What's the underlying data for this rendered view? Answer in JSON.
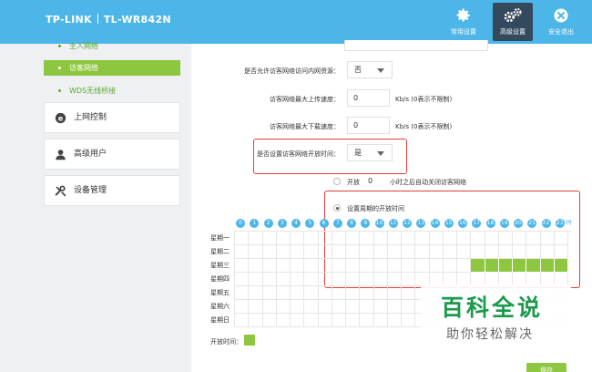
{
  "header": {
    "brand": "TP-LINK",
    "model": "TL-WR842N",
    "buttons": [
      {
        "label": "常用设置",
        "icon": "gear-icon"
      },
      {
        "label": "高级设置",
        "icon": "gears-icon",
        "active": true
      },
      {
        "label": "安全退出",
        "icon": "close-icon"
      }
    ],
    "colors": {
      "bar": "#4cb6e8",
      "active": "#34495e"
    }
  },
  "sidebar": {
    "subitems": [
      "主人网络",
      "访客网络",
      "WDS无线桥接"
    ],
    "active_subitem": "访客网络",
    "menus": [
      "上网控制",
      "高级用户",
      "设备管理"
    ]
  },
  "form": {
    "allow_intranet_label": "是否允许访客网络访问内网资源：",
    "allow_intranet_value": "否",
    "upload_label": "访客网络最大上传速度：",
    "upload_value": "0",
    "upload_unit": "Kb/s (0表示不限制)",
    "download_label": "访客网络最大下载速度：",
    "download_value": "0",
    "download_unit": "Kb/s (0表示不限制)",
    "set_time_label": "是否设置访客网络开放时间：",
    "set_time_value": "是",
    "open_option_prefix": "开放",
    "open_option_hours": "0",
    "open_option_suffix": "小时之后自动关闭访客网络",
    "periodic_option": "设置周期的开放时间"
  },
  "schedule": {
    "hours": [
      "0",
      "1",
      "2",
      "3",
      "4",
      "5",
      "6",
      "7",
      "8",
      "9",
      "10",
      "11",
      "12",
      "13",
      "14",
      "15",
      "16",
      "17",
      "18",
      "19",
      "20",
      "21",
      "22",
      "23"
    ],
    "hour_unit": "小时",
    "days": [
      "星期一",
      "星期二",
      "星期三",
      "星期四",
      "星期五",
      "星期六",
      "星期日"
    ],
    "open_cells": [
      {
        "day": 2,
        "hours": [
          17,
          18,
          19,
          20,
          21,
          22,
          23
        ]
      }
    ],
    "legend_label": "开放时间：",
    "on_color": "#8dc63f"
  },
  "save_label": "保存",
  "watermark": {
    "title": "百科全说",
    "subtitle": "助你轻松解决"
  }
}
